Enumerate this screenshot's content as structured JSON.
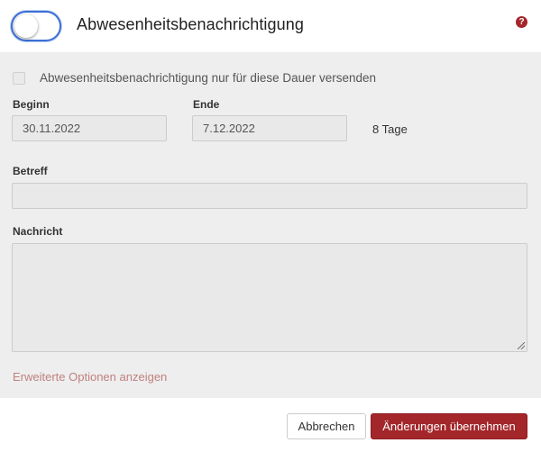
{
  "header": {
    "title": "Abwesenheitsbenachrichtigung",
    "toggle_on": false,
    "help_glyph": "?",
    "help_icon": "question-circle-icon"
  },
  "form": {
    "duration_checkbox": {
      "label": "Abwesenheitsbenachrichtigung nur für diese Dauer versenden",
      "checked": false
    },
    "start": {
      "label": "Beginn",
      "value": "30.11.2022"
    },
    "end": {
      "label": "Ende",
      "value": "7.12.2022"
    },
    "duration_text": "8 Tage",
    "subject": {
      "label": "Betreff",
      "value": ""
    },
    "message": {
      "label": "Nachricht",
      "value": ""
    },
    "advanced_link": "Erweiterte Optionen anzeigen"
  },
  "footer": {
    "cancel_label": "Abbrechen",
    "apply_label": "Änderungen übernehmen"
  },
  "colors": {
    "accent": "#a3262a",
    "toggle_border": "#3b6fd4",
    "panel_background": "#eeeeee",
    "link": "#c08080"
  }
}
